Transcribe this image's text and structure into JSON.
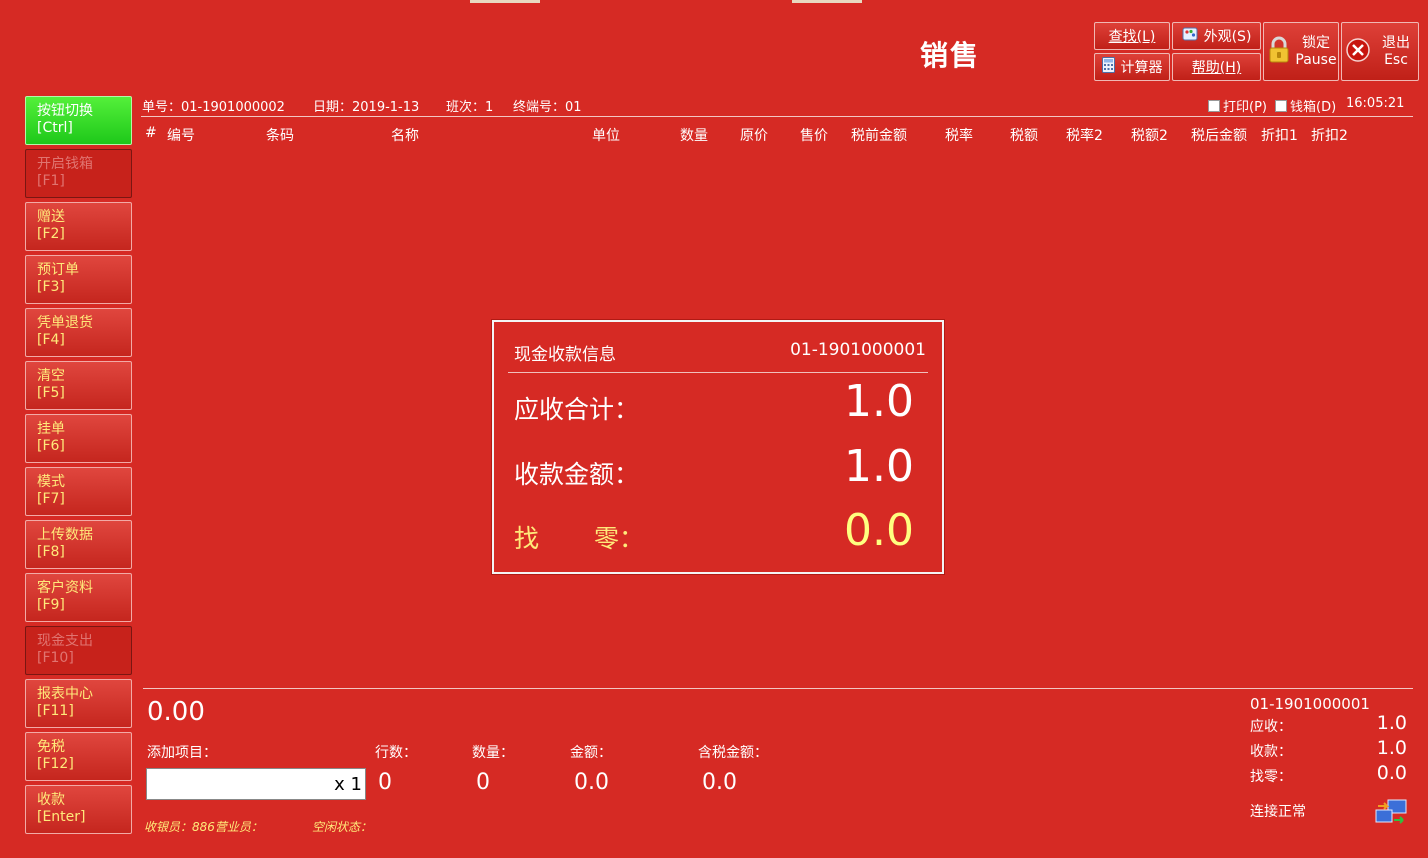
{
  "window": {
    "title": "销售"
  },
  "toolbar": {
    "find": "查找(L)",
    "appearance": "外观(S)",
    "calculator": "计算器",
    "help": "帮助(H)",
    "lock": {
      "label": "锁定",
      "key": "Pause"
    },
    "exit": {
      "label": "退出",
      "key": "Esc"
    }
  },
  "info": {
    "order": "单号：01-1901000002",
    "date": "日期：2019-1-13",
    "shift": "班次：1",
    "terminal": "终端号：01",
    "print": "打印(P)",
    "cashbox": "钱箱(D)",
    "time": "16:05:21"
  },
  "columns": [
    "#",
    "编号",
    "条码",
    "名称",
    "单位",
    "数量",
    "原价",
    "售价",
    "税前金额",
    "税率",
    "税额",
    "税率2",
    "税额2",
    "税后金额",
    "折扣1",
    "折扣2"
  ],
  "sidebar": [
    {
      "label": "按钮切换",
      "key": "[Ctrl]",
      "state": "active"
    },
    {
      "label": "开启钱箱",
      "key": "[F1]",
      "state": "disabled"
    },
    {
      "label": "赠送",
      "key": "[F2]",
      "state": "normal"
    },
    {
      "label": "预订单",
      "key": "[F3]",
      "state": "normal"
    },
    {
      "label": "凭单退货",
      "key": "[F4]",
      "state": "normal"
    },
    {
      "label": "清空",
      "key": "[F5]",
      "state": "normal"
    },
    {
      "label": "挂单",
      "key": "[F6]",
      "state": "normal"
    },
    {
      "label": "模式",
      "key": "[F7]",
      "state": "normal"
    },
    {
      "label": "上传数据",
      "key": "[F8]",
      "state": "normal"
    },
    {
      "label": "客户资料",
      "key": "[F9]",
      "state": "normal"
    },
    {
      "label": "现金支出",
      "key": "[F10]",
      "state": "disabled"
    },
    {
      "label": "报表中心",
      "key": "[F11]",
      "state": "normal"
    },
    {
      "label": "免税",
      "key": "[F12]",
      "state": "normal"
    },
    {
      "label": "收款",
      "key": "[Enter]",
      "state": "normal"
    }
  ],
  "dialog": {
    "title": "现金收款信息",
    "order": "01-1901000001",
    "due_label": "应收合计：",
    "due_value": "1.0",
    "paid_label": "收款金额：",
    "paid_value": "1.0",
    "change_label_1": "找",
    "change_label_2": "零：",
    "change_value": "0.0"
  },
  "bottom": {
    "big_total": "0.00",
    "add_item_label": "添加项目：",
    "qty_suffix": "x 1",
    "rows_label": "行数：",
    "rows_value": "0",
    "count_label": "数量：",
    "count_value": "0",
    "amount_label": "金额：",
    "amount_value": "0.0",
    "tax_amount_label": "含税金额：",
    "tax_amount_value": "0.0",
    "status_cashier": "收银员：886营业员：",
    "status_idle": "空闲状态："
  },
  "receipt": {
    "order": "01-1901000001",
    "due_label": "应收：",
    "due_value": "1.0",
    "paid_label": "收款：",
    "paid_value": "1.0",
    "change_label": "找零：",
    "change_value": "0.0",
    "connection": "连接正常"
  },
  "colors": {
    "background": "#d62a24",
    "active_button": "#2ed926",
    "side_label": "#ffe97a",
    "change_value": "#ffff80",
    "status_text": "#ffe97a"
  }
}
